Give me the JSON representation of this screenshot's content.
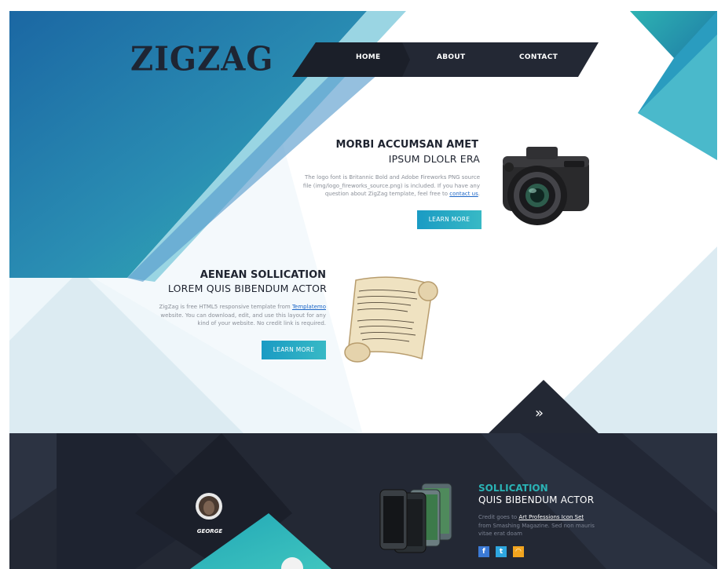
{
  "brand": {
    "logo": "ZIGZAG"
  },
  "nav": {
    "items": [
      {
        "label": "HOME"
      },
      {
        "label": "ABOUT"
      },
      {
        "label": "CONTACT"
      }
    ]
  },
  "feature1": {
    "title": "MORBI ACCUMSAN AMET",
    "subtitle": "IPSUM DLOLR ERA",
    "text_line1": "The logo font is Britannic Bold and Adobe Fireworks PNG source",
    "text_line2": "file (img/logo_fireworks_source.png) is included. If you have any",
    "text_line3": "question about ZigZag template, feel free to",
    "link": "contact us",
    "text_end": ".",
    "button": "LEARN MORE",
    "image_icon": "camera-image"
  },
  "feature2": {
    "title": "AENEAN SOLLICATION",
    "subtitle": "LOREM QUIS BIBENDUM ACTOR",
    "text_line1": "ZigZag is free HTML5 responsive template from",
    "link": "Templatemo",
    "text_line2": "website. You can download, edit, and use this layout for any",
    "text_line3": "kind of your website. No credit link is required.",
    "button": "LEARN MORE",
    "image_icon": "scroll-image"
  },
  "scroll_down_icon": "double-chevron-right-icon",
  "bottom": {
    "team": {
      "name": "GEORGE"
    },
    "section": {
      "title": "SOLLICATION",
      "subtitle": "QUIS BIBENDUM ACTOR",
      "credit_prefix": "Credit goes to",
      "credit_link": "Art Professions Icon Set",
      "line2": "from Smashing Magazine. Sed non mauris",
      "line3": "vitae erat doam"
    },
    "social": [
      {
        "icon": "facebook-icon",
        "glyph": "f",
        "color": "#3b7ad6"
      },
      {
        "icon": "twitter-icon",
        "glyph": "t",
        "color": "#2ea7e0"
      },
      {
        "icon": "rss-icon",
        "glyph": "◠",
        "color": "#f2a51f"
      }
    ]
  },
  "colors": {
    "dark": "#232834",
    "teal": "#2ab3b5",
    "blue": "#1f6fa8",
    "light": "#e6f2f7"
  }
}
